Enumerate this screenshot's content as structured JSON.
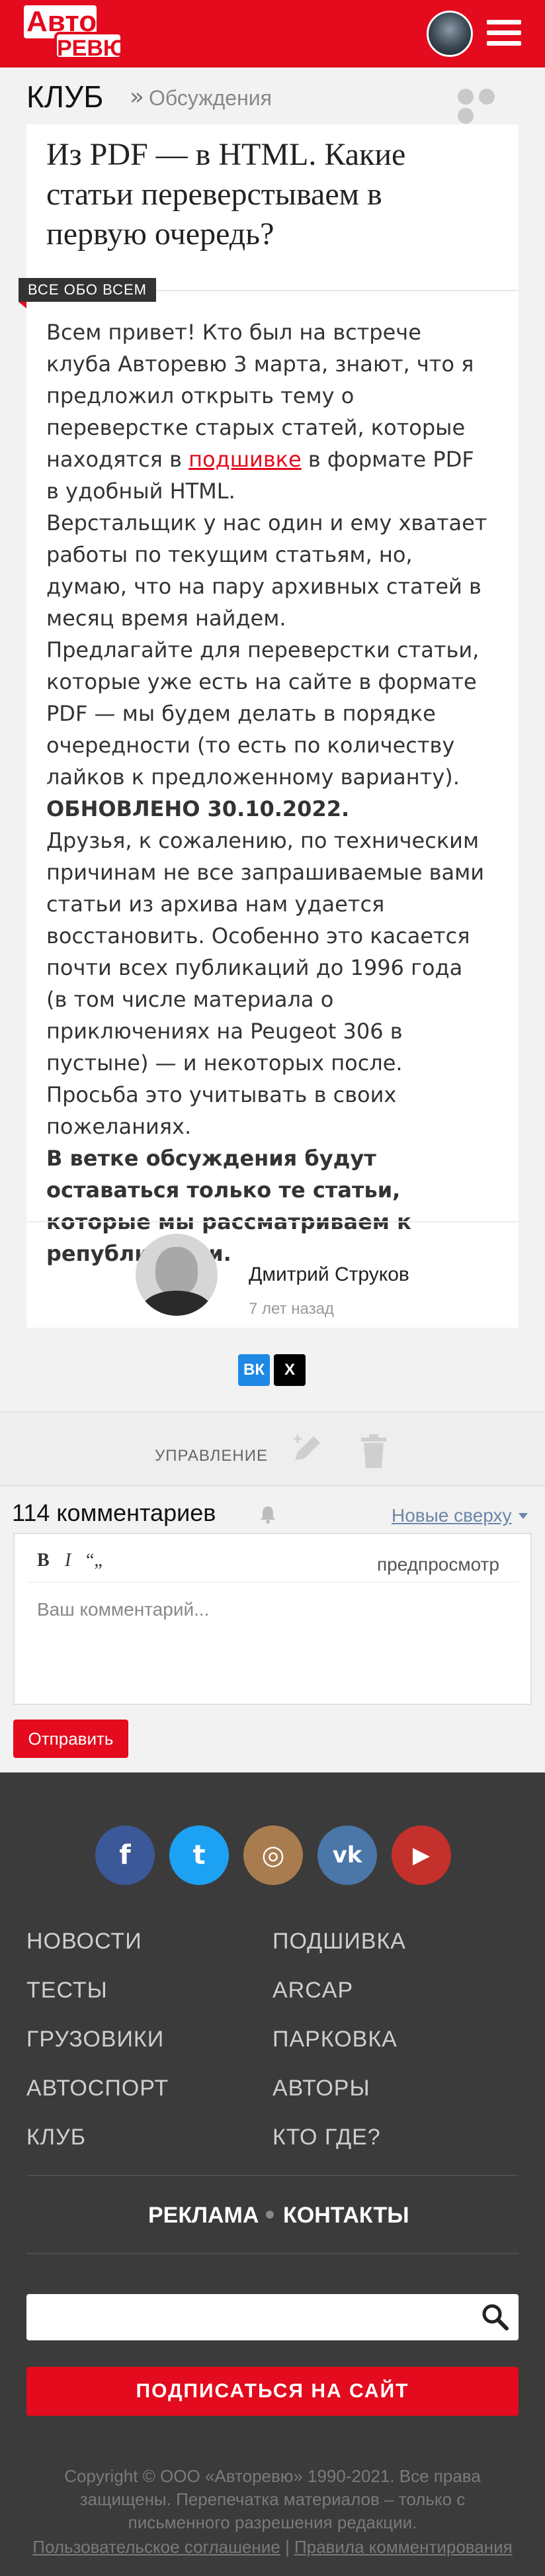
{
  "header": {
    "logo_top": "Авто",
    "logo_bottom": "РЕВЮ",
    "menu_icon": "hamburger-icon",
    "avatar_icon": "user-avatar"
  },
  "breadcrumb": {
    "section": "КЛУБ",
    "separator": "»",
    "current": "Обсуждения"
  },
  "article": {
    "title": "Из PDF — в HTML. Какие статьи переверстываем в первую очередь?",
    "tag": "ВСЕ ОБО ВСЕМ",
    "p1_before": "Всем привет! Кто был на встрече клуба Авторевю 3 марта, знают, что я предложил открыть тему о переверстке старых статей, которые находятся в ",
    "p1_link": "подшивке",
    "p1_after": " в формате PDF в удобный HTML.",
    "p2": "Верстальщик у нас один и ему хватает работы по текущим статьям, но, думаю, что на пару архивных статей в месяц время найдем.",
    "p3": "Предлагайте для переверстки статьи, которые уже есть на сайте в формате PDF — мы будем делать в порядке очередности (то есть по количеству лайков к предложенному варианту).",
    "p4_bold": "ОБНОВЛЕНО 30.10.2022.",
    "p5": "Друзья, к сожалению, по техническим причинам не все запрашиваемые вами статьи из архива нам удается восстановить. Особенно это касается почти всех публикаций до 1996 года (в том числе материала о приключениях на Peugeot 306 в пустыне) — и некоторых после. Просьба это учитывать в своих пожеланиях.",
    "p6_bold": "В ветке обсуждения будут оставаться только те статьи, которые мы рассматриваем к републикации.",
    "author_name": "Дмитрий Струков",
    "author_time": "7 лет назад"
  },
  "share": {
    "vk_label": "ВК",
    "x_label": "X"
  },
  "manage": {
    "label": "УПРАВЛЕНИЕ",
    "edit_icon": "pencil-icon",
    "delete_icon": "trash-icon"
  },
  "comments": {
    "count_text": "114 комментариев",
    "sort_label": "Новые сверху",
    "bold_btn": "B",
    "italic_btn": "I",
    "quote_btn": "“„",
    "preview": "предпросмотр",
    "placeholder": "Ваш комментарий...",
    "send": "Отправить"
  },
  "footer": {
    "social": [
      {
        "name": "facebook",
        "glyph": "f",
        "color": "#3b5998"
      },
      {
        "name": "twitter",
        "glyph": "t",
        "color": "#1da1f2"
      },
      {
        "name": "instagram",
        "glyph": "◎",
        "color": "#a97c50"
      },
      {
        "name": "vk",
        "glyph": "vk",
        "color": "#4a76a8"
      },
      {
        "name": "youtube",
        "glyph": "▶",
        "color": "#c4302b"
      }
    ],
    "menu_left": [
      "НОВОСТИ",
      "ТЕСТЫ",
      "ГРУЗОВИКИ",
      "АВТОСПОРТ",
      "КЛУБ"
    ],
    "menu_right": [
      "ПОДШИВКА",
      "ARCAP",
      "ПАРКОВКА",
      "АВТОРЫ",
      "КТО ГДЕ?"
    ],
    "ads": "РЕКЛАМА",
    "contacts": "КОНТАКТЫ",
    "subscribe": "ПОДПИСАТЬСЯ НА САЙТ",
    "copyright": "Copyright © ООО «Авторевю» 1990-2021. Все права защищены. Перепечатка материалов – только с письменного разрешения редакции.",
    "terms": "Пользовательское соглашение",
    "legal_sep": " | ",
    "rules": "Правила комментирования"
  },
  "colors": {
    "brand_red": "#e30b1d",
    "footer_bg": "#3b3b3b",
    "sort_link": "#6b86a9"
  }
}
